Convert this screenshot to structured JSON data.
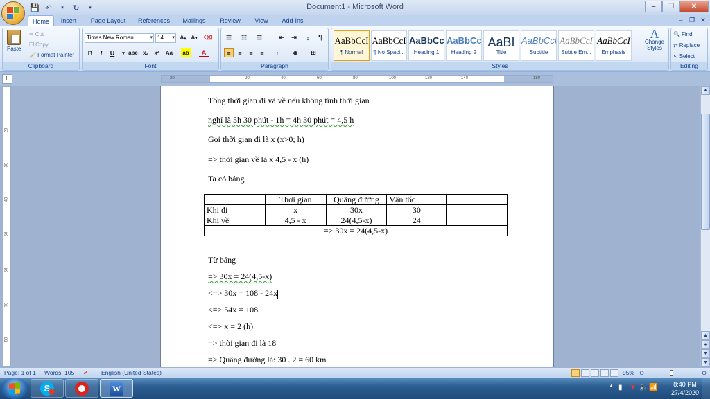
{
  "window": {
    "title": "Document1 - Microsoft Word"
  },
  "tabs": [
    "Home",
    "Insert",
    "Page Layout",
    "References",
    "Mailings",
    "Review",
    "View",
    "Add-Ins"
  ],
  "ribbon": {
    "clipboard": {
      "label": "Clipboard",
      "paste": "Paste",
      "cut": "Cut",
      "copy": "Copy",
      "format_painter": "Format Painter"
    },
    "font": {
      "label": "Font",
      "name": "Times New Roman",
      "size": "14"
    },
    "paragraph": {
      "label": "Paragraph"
    },
    "styles": {
      "label": "Styles",
      "items": [
        {
          "sample": "AaBbCcI",
          "name": "¶ Normal"
        },
        {
          "sample": "AaBbCcI",
          "name": "¶ No Spaci..."
        },
        {
          "sample": "AaBbCc",
          "name": "Heading 1"
        },
        {
          "sample": "AaBbCc",
          "name": "Heading 2"
        },
        {
          "sample": "AaBI",
          "name": "Title"
        },
        {
          "sample": "AaBbCcI",
          "name": "Subtitle"
        },
        {
          "sample": "AaBbCcI",
          "name": "Subtle Em..."
        },
        {
          "sample": "AaBbCcI",
          "name": "Emphasis"
        }
      ],
      "change_styles": "Change Styles"
    },
    "editing": {
      "label": "Editing",
      "find": "Find",
      "replace": "Replace",
      "select": "Select"
    }
  },
  "document": {
    "lines_top": [
      "Tổng thời gian đi và về nếu không tính thời gian",
      "nghỉ là 5h 30 phút - 1h = 4h 30 phút = 4,5 h",
      "Gọi thời gian đi là x (x>0; h)",
      "=> thời gian về là x 4,5 - x (h)",
      "Ta có bảng"
    ],
    "table": {
      "header": [
        "",
        "Thời gian",
        "Quãng đường",
        "Vận tốc",
        ""
      ],
      "rows": [
        [
          "Khi đi",
          "x",
          "30x",
          "30",
          ""
        ],
        [
          "Khi về",
          "4,5 - x",
          "24(4,5-x)",
          "24",
          ""
        ]
      ],
      "footer": "=> 30x = 24(4,5-x)"
    },
    "lines_bottom": [
      "Từ bảng",
      "=>  30x = 24(4,5-x)",
      "<=> 30x = 108 - 24x",
      "<=> 54x = 108",
      "<=>  x = 2 (h)",
      "=> thời gian đi là 18",
      "=> Quãng đường là: 30 . 2 = 60 km"
    ]
  },
  "status": {
    "page": "Page: 1 of 1",
    "words": "Words: 105",
    "language": "English (United States)",
    "zoom": "95%"
  },
  "taskbar": {
    "time": "8:40 PM",
    "date": "27/4/2020"
  }
}
